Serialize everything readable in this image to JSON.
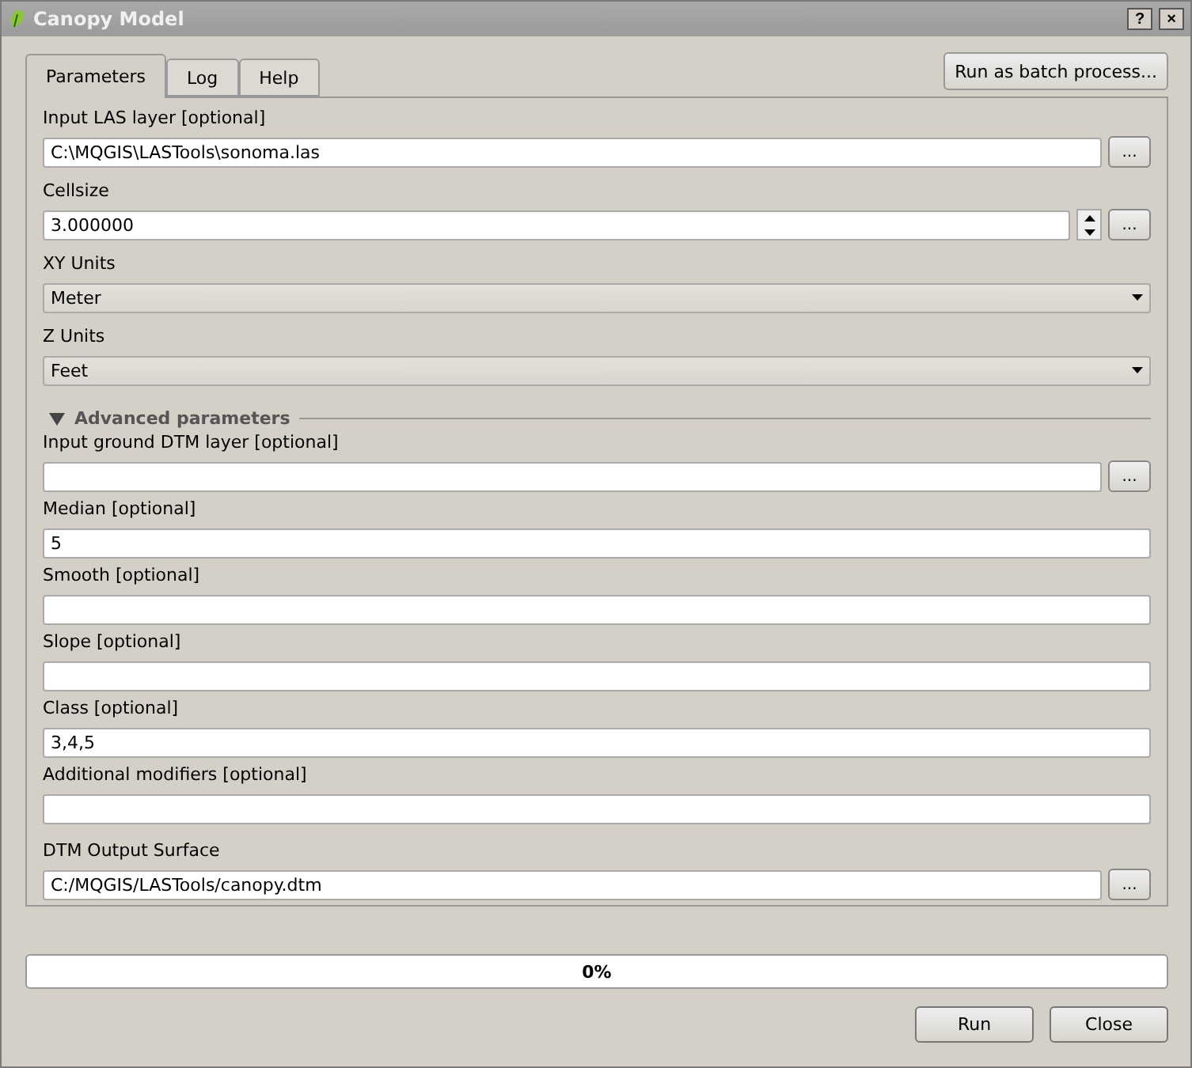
{
  "window": {
    "title": "Canopy Model",
    "controls": [
      "?",
      "×"
    ]
  },
  "tabs": [
    {
      "label": "Parameters",
      "selected": true
    },
    {
      "label": "Log",
      "selected": false
    },
    {
      "label": "Help",
      "selected": false
    }
  ],
  "batch_button": "Run as batch process...",
  "fields": [
    {
      "kind": "file",
      "label": "Input LAS layer [optional]",
      "value": "C:\\MQGIS\\LASTools\\sonoma.las",
      "browse": "..."
    },
    {
      "kind": "spin",
      "label": "Cellsize",
      "value": "3.000000",
      "browse": "..."
    },
    {
      "kind": "combo",
      "label": "XY Units",
      "value": "Meter"
    },
    {
      "kind": "combo",
      "label": "Z Units",
      "value": "Feet"
    }
  ],
  "advanced": {
    "title": "Advanced parameters",
    "expanded": true,
    "fields": [
      {
        "kind": "file",
        "label": "Input ground DTM layer [optional]",
        "browse": "..."
      },
      {
        "kind": "text",
        "label": "Median [optional]",
        "value": "5"
      },
      {
        "kind": "text",
        "label": "Smooth [optional]"
      },
      {
        "kind": "text",
        "label": "Slope [optional]"
      },
      {
        "kind": "text",
        "label": "Class [optional]",
        "value": "3,4,5"
      },
      {
        "kind": "text",
        "label": "Additional modifiers [optional]"
      }
    ]
  },
  "output": {
    "kind": "file",
    "label": "DTM Output Surface",
    "value": "C:/MQGIS/LASTools/canopy.dtm",
    "browse": "..."
  },
  "progress": {
    "level": 0,
    "text": "0%"
  },
  "buttons": [
    "Run",
    "Close"
  ]
}
